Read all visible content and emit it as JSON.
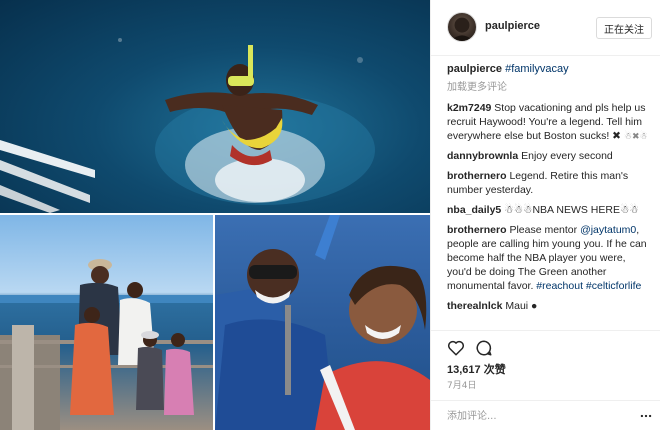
{
  "post": {
    "username": "paulpierce",
    "follow_label": "正在关注",
    "caption": {
      "username": "paulpierce",
      "hashtag": "#familyvacay"
    },
    "load_more_label": "加载更多评论",
    "comments": [
      {
        "username": "k2m7249",
        "text": "Stop vacationing and pls help us recruit Haywood! You're a legend. Tell him everywhere else but Boston sucks! ✖",
        "extra": "☃✖☃"
      },
      {
        "username": "dannybrownla",
        "text": "Enjoy every second"
      },
      {
        "username": "brothernero",
        "text": "Legend. Retire this man's number yesterday."
      },
      {
        "username": "nba_daily5",
        "text": "☃☃☃NBA NEWS HERE☃☃"
      },
      {
        "username": "brothernero",
        "text_before": "Please mentor ",
        "mention": "@jaytatum0",
        "text_after": ", people are calling him young you. If he can become half the NBA player you were, you'd be doing The Green another monumental favor. ",
        "tag1": "#reachout",
        "tag2": "#celticforlife"
      },
      {
        "username": "therealnlck",
        "text": "Maui ●"
      }
    ],
    "likes_count": "13,617",
    "likes_unit": "次赞",
    "date": "7月4日",
    "add_comment_placeholder": "添加评论...",
    "icons": {
      "like": "heart-icon",
      "comment": "comment-icon",
      "more": "more-options-icon"
    }
  }
}
